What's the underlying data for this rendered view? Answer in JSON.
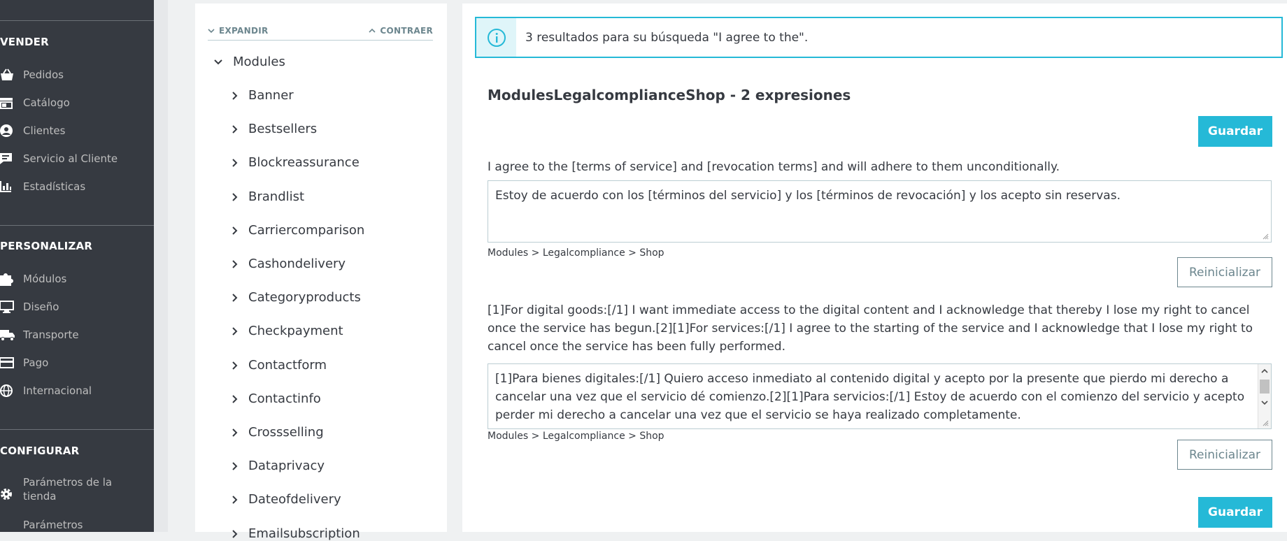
{
  "sidebar": {
    "sections": [
      {
        "title": "VENDER"
      },
      {
        "title": "PERSONALIZAR"
      },
      {
        "title": "CONFIGURAR"
      }
    ],
    "items": [
      {
        "label": "Pedidos",
        "icon": "basket-icon"
      },
      {
        "label": "Catálogo",
        "icon": "store-icon"
      },
      {
        "label": "Clientes",
        "icon": "user-icon"
      },
      {
        "label": "Servicio al Cliente",
        "icon": "chat-icon"
      },
      {
        "label": "Estadísticas",
        "icon": "bar-chart-icon"
      },
      {
        "label": "Módulos",
        "icon": "puzzle-icon"
      },
      {
        "label": "Diseño",
        "icon": "monitor-icon"
      },
      {
        "label": "Transporte",
        "icon": "truck-icon"
      },
      {
        "label": "Pago",
        "icon": "credit-card-icon"
      },
      {
        "label": "Internacional",
        "icon": "globe-icon"
      },
      {
        "label": "Parámetros de la tienda",
        "icon": "gear-icon"
      },
      {
        "label": "Parámetros",
        "icon": ""
      }
    ]
  },
  "tree": {
    "expand_label": "EXPANDIR",
    "collapse_label": "CONTRAER",
    "root": "Modules",
    "items": [
      "Banner",
      "Bestsellers",
      "Blockreassurance",
      "Brandlist",
      "Carriercomparison",
      "Cashondelivery",
      "Categoryproducts",
      "Checkpayment",
      "Contactform",
      "Contactinfo",
      "Crossselling",
      "Dataprivacy",
      "Dateofdelivery",
      "Emailsubscription"
    ]
  },
  "main": {
    "alert_text": "3 resultados para su búsqueda \"I agree to the\".",
    "section_title": "ModulesLegalcomplianceShop - 2 expresiones",
    "save_label": "Guardar",
    "reset_label": "Reinicializar",
    "expressions": [
      {
        "original": "I agree to the [terms of service] and [revocation terms] and will adhere to them unconditionally.",
        "translation": "Estoy de acuerdo con los [términos del servicio] y los [términos de revocación] y los acepto sin reservas.",
        "breadcrumb": "Modules > Legalcompliance > Shop"
      },
      {
        "original": "[1]For digital goods:[/1] I want immediate access to the digital content and I acknowledge that thereby I lose my right to cancel once the service has begun.[2][1]For services:[/1] I agree to the starting of the service and I acknowledge that I lose my right to cancel once the service has been fully performed.",
        "translation": "[1]Para bienes digitales:[/1] Quiero acceso inmediato al contenido digital y acepto por la presente que pierdo mi derecho a cancelar una vez que el servicio dé comienzo.[2][1]Para servicios:[/1] Estoy de acuerdo con el comienzo del servicio y acepto perder mi derecho a cancelar una vez que el servicio se haya realizado completamente.",
        "breadcrumb": "Modules > Legalcompliance > Shop"
      }
    ]
  },
  "colors": {
    "sidebar_bg": "#363a41",
    "accent": "#25b9d7",
    "page_bg": "#eff1f2"
  }
}
